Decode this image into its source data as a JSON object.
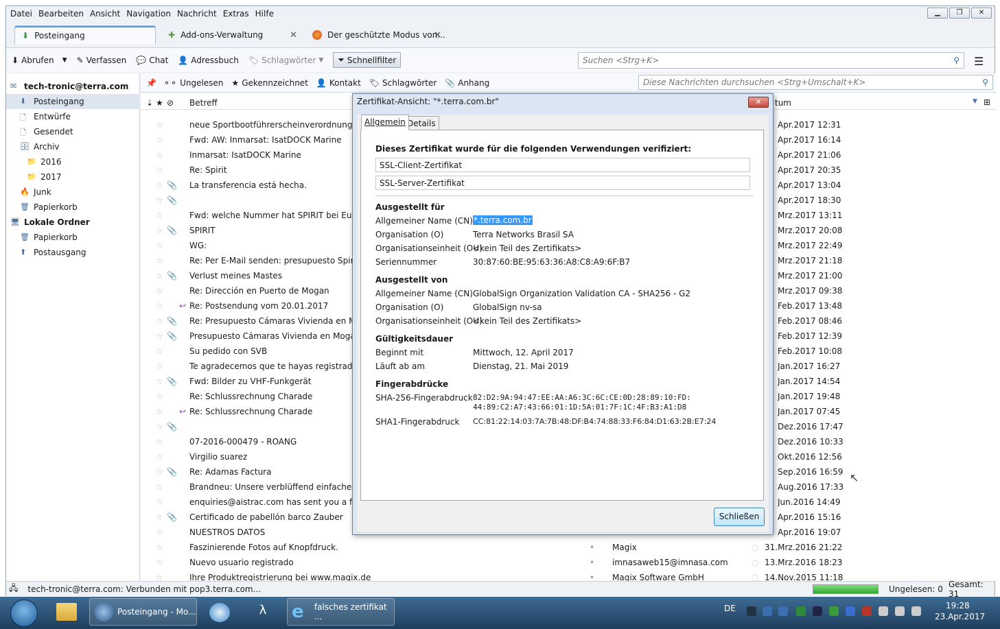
{
  "menu": [
    "Datei",
    "Bearbeiten",
    "Ansicht",
    "Navigation",
    "Nachricht",
    "Extras",
    "Hilfe"
  ],
  "tabs": [
    {
      "label": "Posteingang",
      "active": true
    },
    {
      "label": "Add-ons-Verwaltung",
      "active": false
    },
    {
      "label": "Der geschützte Modus von...",
      "active": false
    }
  ],
  "toolbar": {
    "fetch": "Abrufen",
    "compose": "Verfassen",
    "chat": "Chat",
    "addressbook": "Adressbuch",
    "tags": "Schlagwörter",
    "quickfilter": "Schnellfilter",
    "search_placeholder": "Suchen <Strg+K>"
  },
  "folders": [
    {
      "label": "tech-tronic@terra.com",
      "level": 0,
      "bold": true,
      "icon": "account-icon"
    },
    {
      "label": "Posteingang",
      "level": 1,
      "selected": true,
      "icon": "inbox-icon"
    },
    {
      "label": "Entwürfe",
      "level": 1,
      "icon": "drafts-icon"
    },
    {
      "label": "Gesendet",
      "level": 1,
      "icon": "sent-icon"
    },
    {
      "label": "Archiv",
      "level": 1,
      "icon": "archive-icon"
    },
    {
      "label": "2016",
      "level": 2,
      "icon": "folder-icon"
    },
    {
      "label": "2017",
      "level": 2,
      "icon": "folder-icon"
    },
    {
      "label": "Junk",
      "level": 1,
      "icon": "junk-icon"
    },
    {
      "label": "Papierkorb",
      "level": 1,
      "icon": "trash-icon"
    },
    {
      "label": "Lokale Ordner",
      "level": 0,
      "bold": true,
      "icon": "local-folders-icon"
    },
    {
      "label": "Papierkorb",
      "level": 1,
      "icon": "trash-icon"
    },
    {
      "label": "Postausgang",
      "level": 1,
      "icon": "outbox-icon"
    }
  ],
  "quickfilter": {
    "unread": "Ungelesen",
    "starred": "Gekennzeichnet",
    "contact": "Kontakt",
    "tags": "Schlagwörter",
    "attachment": "Anhang",
    "search_placeholder": "Diese Nachrichten durchsuchen <Strg+Umschalt+K>"
  },
  "columns": {
    "subject": "Betreff",
    "date": "tum"
  },
  "messages": [
    {
      "subject": "neue Sportbootführerscheinverordnung",
      "date": "Apr.2017 12:31",
      "attach": false
    },
    {
      "subject": "Fwd: AW: Inmarsat: IsatDOCK Marine",
      "date": "Apr.2017 16:14",
      "attach": false
    },
    {
      "subject": "Inmarsat: IsatDOCK Marine",
      "date": "Apr.2017 21:06",
      "attach": false
    },
    {
      "subject": "Re: Spirit",
      "date": "Apr.2017 20:35",
      "attach": false
    },
    {
      "subject": "La transferencia está hecha.",
      "date": "Apr.2017 13:04",
      "attach": true
    },
    {
      "subject": "",
      "date": "Apr.2017 18:30",
      "attach": true
    },
    {
      "subject": "Fwd: welche Nummer hat SPIRIT bei Euch",
      "date": "Mrz.2017 13:11",
      "attach": false
    },
    {
      "subject": "SPIRIT",
      "date": "Mrz.2017 20:08",
      "attach": true
    },
    {
      "subject": "WG:",
      "date": "Mrz.2017 22:49",
      "attach": false
    },
    {
      "subject": "Re: Per E-Mail senden: presupuesto Spirit, And",
      "date": "Mrz.2017 21:18",
      "attach": false
    },
    {
      "subject": "Verlust meines Mastes",
      "date": "Mrz.2017 21:00",
      "attach": true
    },
    {
      "subject": "Re: Dirección en Puerto de Mogan",
      "date": "Mrz.2017 09:38",
      "attach": false
    },
    {
      "subject": "Re: Postsendung vom 20.01.2017",
      "date": "Feb.2017 13:48",
      "attach": false,
      "replied": true
    },
    {
      "subject": "Re: Presupuesto Cámaras Vivienda en Mogán",
      "date": "Feb.2017 08:46",
      "attach": true
    },
    {
      "subject": "Presupuesto Cámaras Vivienda en Mogán",
      "date": "Feb.2017 12:39",
      "attach": true
    },
    {
      "subject": "Su pedido con SVB",
      "date": "Feb.2017 10:08",
      "attach": false
    },
    {
      "subject": "Te agradecemos que te hayas registrado con",
      "date": "Jan.2017 16:27",
      "attach": false
    },
    {
      "subject": "Fwd: Bilder zu VHF-Funkgerät",
      "date": "Jan.2017 14:54",
      "attach": true
    },
    {
      "subject": "Re: Schlussrechnung Charade",
      "date": "Jan.2017 19:48",
      "attach": false
    },
    {
      "subject": "Re: Schlussrechnung Charade",
      "date": "Jan.2017 07:45",
      "attach": false,
      "replied": true
    },
    {
      "subject": "",
      "date": "Dez.2016 17:47",
      "attach": true
    },
    {
      "subject": "07-2016-000479 - ROANG",
      "date": "Dez.2016 10:33",
      "attach": false
    },
    {
      "subject": "Virgilio suarez",
      "date": "Okt.2016 12:56",
      "attach": false
    },
    {
      "subject": "Re: Adamas Factura",
      "date": "Sep.2016 16:59",
      "attach": true
    },
    {
      "subject": "Brandneu: Unsere verblüffend einfache Bildop",
      "date": "Aug.2016 17:33",
      "attach": false
    },
    {
      "subject": "enquiries@aistrac.com has sent you a file via",
      "date": "Jun.2016 14:49",
      "attach": false
    },
    {
      "subject": "Certificado de pabellón barco Zauber",
      "date": "Apr.2016 15:16",
      "attach": true
    },
    {
      "subject": "NUESTROS DATOS",
      "date": "Apr.2016 19:07",
      "attach": false
    },
    {
      "subject": "Faszinierende Fotos auf Knopfdruck.",
      "sender": "Magix",
      "date": "31.Mrz.2016 21:22",
      "attach": false
    },
    {
      "subject": "Nuevo usuario registrado",
      "sender": "imnasaweb15@imnasa.com",
      "date": "13.Mrz.2016 18:23",
      "attach": false
    },
    {
      "subject": "Ihre Produktregistrierung bei www.magix.de",
      "sender": "Magix Software GmbH",
      "date": "14.Nov.2015 11:18",
      "attach": false
    }
  ],
  "status": {
    "connection": "tech-tronic@terra.com: Verbunden mit pop3.terra.com...",
    "unread": "Ungelesen: 0",
    "total": "Gesamt: 31"
  },
  "dialog": {
    "title": "Zertifikat-Ansicht: \"*.terra.com.br\"",
    "tab_general": "Allgemein",
    "tab_details": "Details",
    "verified_heading": "Dieses Zertifikat wurde für die folgenden Verwendungen verifiziert:",
    "usage1": "SSL-Client-Zertifikat",
    "usage2": "SSL-Server-Zertifikat",
    "issued_to": "Ausgestellt für",
    "cn_label": "Allgemeiner Name (CN)",
    "cn_value": "*.terra.com.br",
    "o_label": "Organisation (O)",
    "o_value": "Terra Networks Brasil SA",
    "ou_label": "Organisationseinheit (OU)",
    "ou_value": "<kein Teil des Zertifikats>",
    "serial_label": "Seriennummer",
    "serial_value": "30:87:60:BE:95:63:36:A8:C8:A9:6F:B7",
    "issued_by": "Ausgestellt von",
    "icn_value": "GlobalSign Organization Validation CA - SHA256 - G2",
    "io_value": "GlobalSign nv-sa",
    "iou_value": "<kein Teil des Zertifikats>",
    "validity": "Gültigkeitsdauer",
    "begins_label": "Beginnt mit",
    "begins_value": "Mittwoch, 12. April 2017",
    "expires_label": "Läuft ab am",
    "expires_value": "Dienstag, 21. Mai 2019",
    "fingerprints": "Fingerabdrücke",
    "sha256_label": "SHA-256-Fingerabdruck",
    "sha256_line1": "82:D2:9A:94:47:EE:AA:A6:3C:6C:CE:0D:28:89:10:FD:",
    "sha256_line2": "44:89:C2:A7:43:66:01:1D:5A:01:7F:1C:4F:B3:A1:D8",
    "sha1_label": "SHA1-Fingerabdruck",
    "sha1_value": "CC:81:22:14:03:7A:7B:48:DF:B4:74:88:33:F6:84:D1:63:2B:E7:24",
    "close_button": "Schließen"
  },
  "taskbar": {
    "items": [
      {
        "label": "Posteingang - Mo..."
      },
      {
        "label": "falsches zertifikat ..."
      }
    ],
    "lang": "DE",
    "time": "19:28",
    "date": "23.Apr.2017"
  }
}
